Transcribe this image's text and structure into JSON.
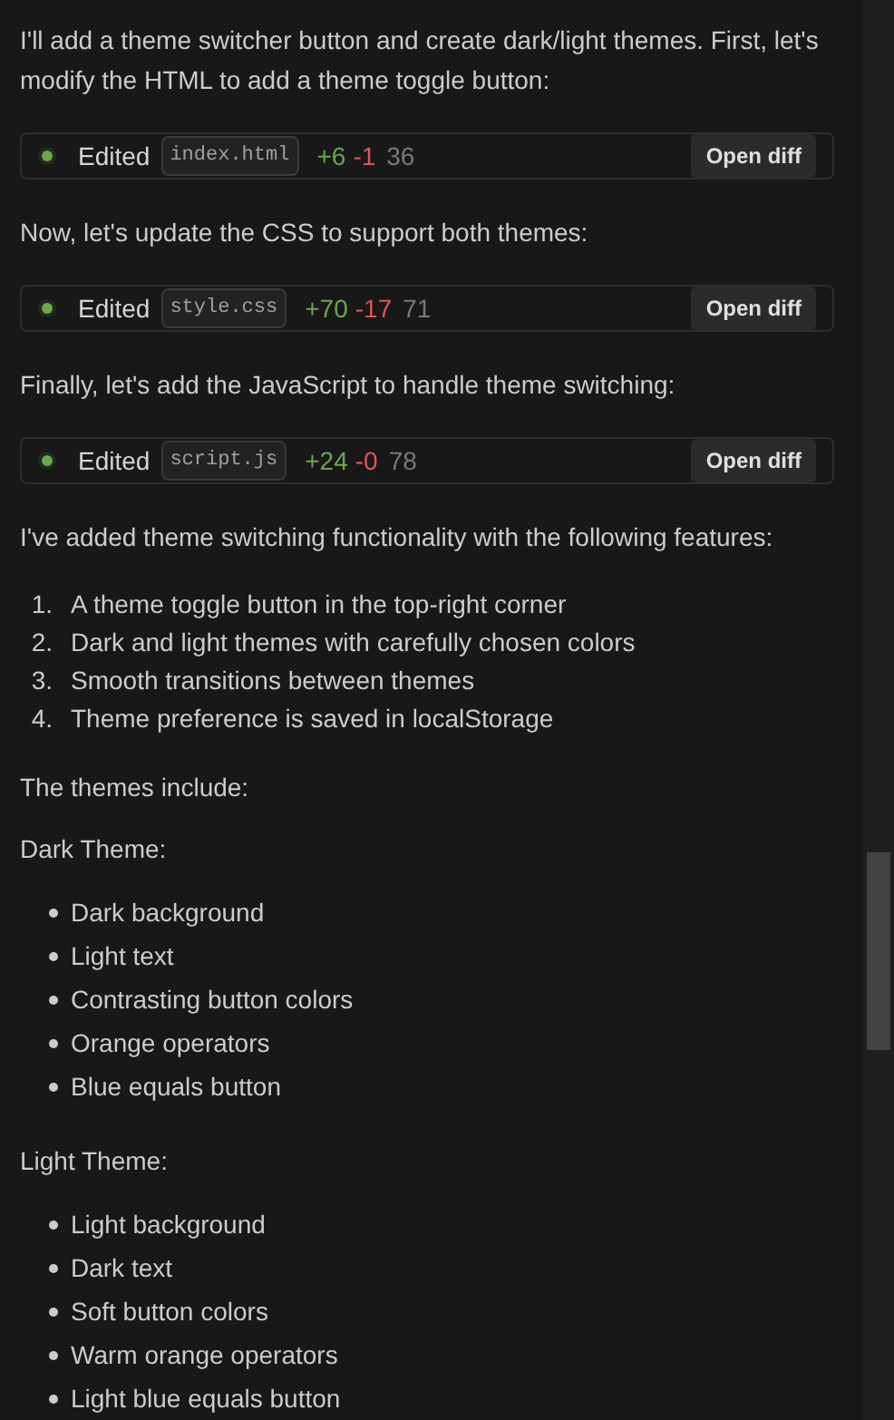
{
  "blocks": [
    {
      "kind": "paragraph",
      "text": "I'll add a theme switcher button and create dark/light themes. First, let's modify the HTML to add a theme toggle button:"
    },
    {
      "kind": "edit",
      "label": "Edited",
      "file": "index.html",
      "added": "+6",
      "removed": "-1",
      "lines": "36",
      "button": "Open diff"
    },
    {
      "kind": "paragraph",
      "text": "Now, let's update the CSS to support both themes:"
    },
    {
      "kind": "edit",
      "label": "Edited",
      "file": "style.css",
      "added": "+70",
      "removed": "-17",
      "lines": "71",
      "button": "Open diff"
    },
    {
      "kind": "paragraph",
      "text": "Finally, let's add the JavaScript to handle theme switching:"
    },
    {
      "kind": "edit",
      "label": "Edited",
      "file": "script.js",
      "added": "+24",
      "removed": "-0",
      "lines": "78",
      "button": "Open diff"
    },
    {
      "kind": "paragraph",
      "text": "I've added theme switching functionality with the following features:"
    },
    {
      "kind": "numbered",
      "items": [
        {
          "marker": "1.",
          "text": "A theme toggle button in the top-right corner"
        },
        {
          "marker": "2.",
          "text": "Dark and light themes with carefully chosen colors"
        },
        {
          "marker": "3.",
          "text": "Smooth transitions between themes"
        },
        {
          "marker": "4.",
          "text": "Theme preference is saved in localStorage"
        }
      ]
    },
    {
      "kind": "paragraph",
      "text": "The themes include:"
    },
    {
      "kind": "heading",
      "text": "Dark Theme:"
    },
    {
      "kind": "bullets",
      "items": [
        "Dark background",
        "Light text",
        "Contrasting button colors",
        "Orange operators",
        "Blue equals button"
      ]
    },
    {
      "kind": "heading",
      "text": "Light Theme:"
    },
    {
      "kind": "bullets",
      "items": [
        "Light background",
        "Dark text",
        "Soft button colors",
        "Warm orange operators",
        "Light blue equals button"
      ]
    }
  ]
}
